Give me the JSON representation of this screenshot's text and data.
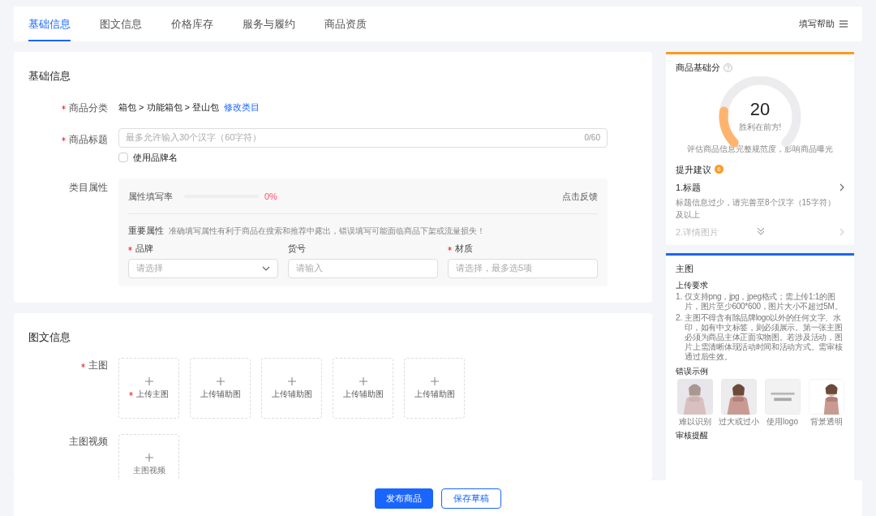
{
  "tabs": [
    {
      "label": "基础信息",
      "selected": true
    },
    {
      "label": "图文信息",
      "selected": false
    },
    {
      "label": "价格库存",
      "selected": false
    },
    {
      "label": "服务与履约",
      "selected": false
    },
    {
      "label": "商品资质",
      "selected": false
    }
  ],
  "help": {
    "label": "填写帮助"
  },
  "basic": {
    "title": "基础信息",
    "category": {
      "label": "商品分类",
      "required": true,
      "path": "箱包 > 功能箱包 > 登山包",
      "link": "修改类目"
    },
    "product_title": {
      "label": "商品标题",
      "required": true,
      "placeholder": "最多允许输入30个汉字（60字符）",
      "counter": "0/60"
    },
    "brand_name": {
      "label": "使用品牌名",
      "checked": false
    },
    "attributes": {
      "label": "类目属性",
      "rate_label": "属性填写率",
      "rate": "0%",
      "feedback": "点击反馈",
      "important_title": "重要属性",
      "important_note": "准确填写属性有利于商品在搜索和推荐中露出，错误填写可能面临商品下架或流量损失！",
      "fields": [
        {
          "label": "品牌",
          "required": true,
          "kind": "select",
          "placeholder": "请选择"
        },
        {
          "label": "货号",
          "required": false,
          "kind": "input",
          "placeholder": "请输入"
        },
        {
          "label": "材质",
          "required": true,
          "kind": "input",
          "placeholder": "请选择，最多选5项"
        }
      ]
    }
  },
  "media": {
    "title": "图文信息",
    "main_images": {
      "label": "主图",
      "required": true,
      "slots": [
        {
          "label": "上传主图",
          "required": true
        },
        {
          "label": "上传辅助图",
          "required": false
        },
        {
          "label": "上传辅助图",
          "required": false
        },
        {
          "label": "上传辅助图",
          "required": false
        },
        {
          "label": "上传辅助图",
          "required": false
        }
      ]
    },
    "video": {
      "label": "主图视频",
      "slot": "主图视频"
    }
  },
  "score": {
    "title": "商品基础分",
    "value": "20",
    "level": 0.2,
    "motto": "胜利在前方!",
    "desc": "评估商品信息完整规范度，影响商品曝光",
    "suggest_title": "提升建议",
    "suggest_count": "6",
    "suggestions": [
      {
        "title": "1.标题",
        "desc": "标题信息过少，请完善至8个汉字（15字符）及以上",
        "faded": false
      },
      {
        "title": "2.详情图片",
        "faded": true
      }
    ]
  },
  "guide": {
    "title": "主图",
    "req_title": "上传要求",
    "requirements": [
      {
        "num": "1.",
        "text": "仅支持png，jpg，jpeg格式；需上传1:1的图片，图片至少600*600，图片大小不超过5M。"
      },
      {
        "num": "2.",
        "text": "主图不得含有除品牌logo以外的任何文字、水印，如有中文标签，则必须展示。第一张主图必须为商品主体正面实物图。若涉及活动，图片上需清晰体现活动时间和活动方式。需审核通过后生效。"
      }
    ],
    "examples_title": "错误示例",
    "examples": [
      {
        "caption": "难以识别",
        "kind": "picture"
      },
      {
        "caption": "过大或过小",
        "kind": "picture"
      },
      {
        "caption": "使用logo",
        "kind": "picture"
      },
      {
        "caption": "背景透明",
        "kind": "picture"
      }
    ],
    "review_title": "审核提醒"
  },
  "actions": [
    {
      "label": "发布商品",
      "kind": "primary"
    },
    {
      "label": "保存草稿",
      "kind": "secondary"
    }
  ]
}
